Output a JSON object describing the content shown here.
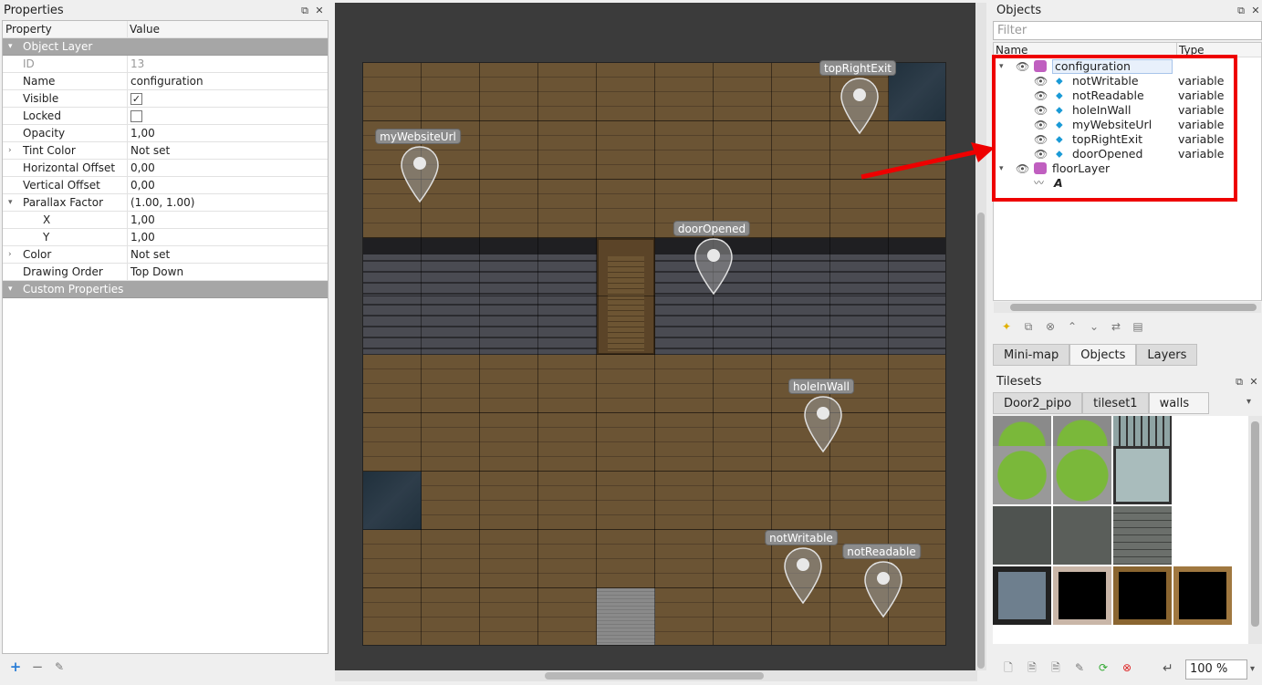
{
  "properties_panel": {
    "title": "Properties",
    "col_property": "Property",
    "col_value": "Value",
    "rows": [
      {
        "key": "Object Layer",
        "value": "",
        "type": "group",
        "expand": "▾"
      },
      {
        "key": "ID",
        "value": "13",
        "type": "disabled"
      },
      {
        "key": "Name",
        "value": "configuration",
        "type": "normal"
      },
      {
        "key": "Visible",
        "value": "✓",
        "type": "checkbox"
      },
      {
        "key": "Locked",
        "value": "",
        "type": "checkbox"
      },
      {
        "key": "Opacity",
        "value": "1,00",
        "type": "normal"
      },
      {
        "key": "Tint Color",
        "value": "Not set",
        "type": "normal",
        "expand": "›"
      },
      {
        "key": "Horizontal Offset",
        "value": "0,00",
        "type": "normal"
      },
      {
        "key": "Vertical Offset",
        "value": "0,00",
        "type": "normal"
      },
      {
        "key": "Parallax Factor",
        "value": "(1.00, 1.00)",
        "type": "normal",
        "expand": "▾"
      },
      {
        "key": "X",
        "value": "1,00",
        "type": "sub"
      },
      {
        "key": "Y",
        "value": "1,00",
        "type": "sub"
      },
      {
        "key": "Color",
        "value": "Not set",
        "type": "normal",
        "expand": "›"
      },
      {
        "key": "Drawing Order",
        "value": "Top Down",
        "type": "normal"
      },
      {
        "key": "Custom Properties",
        "value": "",
        "type": "group",
        "expand": "▾"
      }
    ]
  },
  "map": {
    "objects": [
      {
        "label": "topRightExit"
      },
      {
        "label": "myWebsiteUrl"
      },
      {
        "label": "doorOpened"
      },
      {
        "label": "holeInWall"
      },
      {
        "label": "notWritable"
      },
      {
        "label": "notReadable"
      }
    ]
  },
  "objects_panel": {
    "title": "Objects",
    "filter_placeholder": "Filter",
    "col_name": "Name",
    "col_type": "Type",
    "layers": [
      {
        "name": "configuration",
        "children": [
          {
            "name": "notWritable",
            "type": "variable"
          },
          {
            "name": "notReadable",
            "type": "variable"
          },
          {
            "name": "holeInWall",
            "type": "variable"
          },
          {
            "name": "myWebsiteUrl",
            "type": "variable"
          },
          {
            "name": "topRightExit",
            "type": "variable"
          },
          {
            "name": "doorOpened",
            "type": "variable"
          }
        ]
      },
      {
        "name": "floorLayer",
        "children": [
          {
            "name": "A",
            "type": ""
          }
        ]
      }
    ],
    "tabs": [
      "Mini-map",
      "Objects",
      "Layers"
    ],
    "active_tab": "Objects"
  },
  "tilesets_panel": {
    "title": "Tilesets",
    "tabs": [
      "Door2_pipo",
      "tileset1",
      "walls"
    ],
    "active_tab": "walls",
    "zoom": "100 %"
  },
  "colors": {
    "annotation_red": "#ee0000",
    "layer_icon": "#c05fc0",
    "pin_icon": "#1a9ad6"
  }
}
